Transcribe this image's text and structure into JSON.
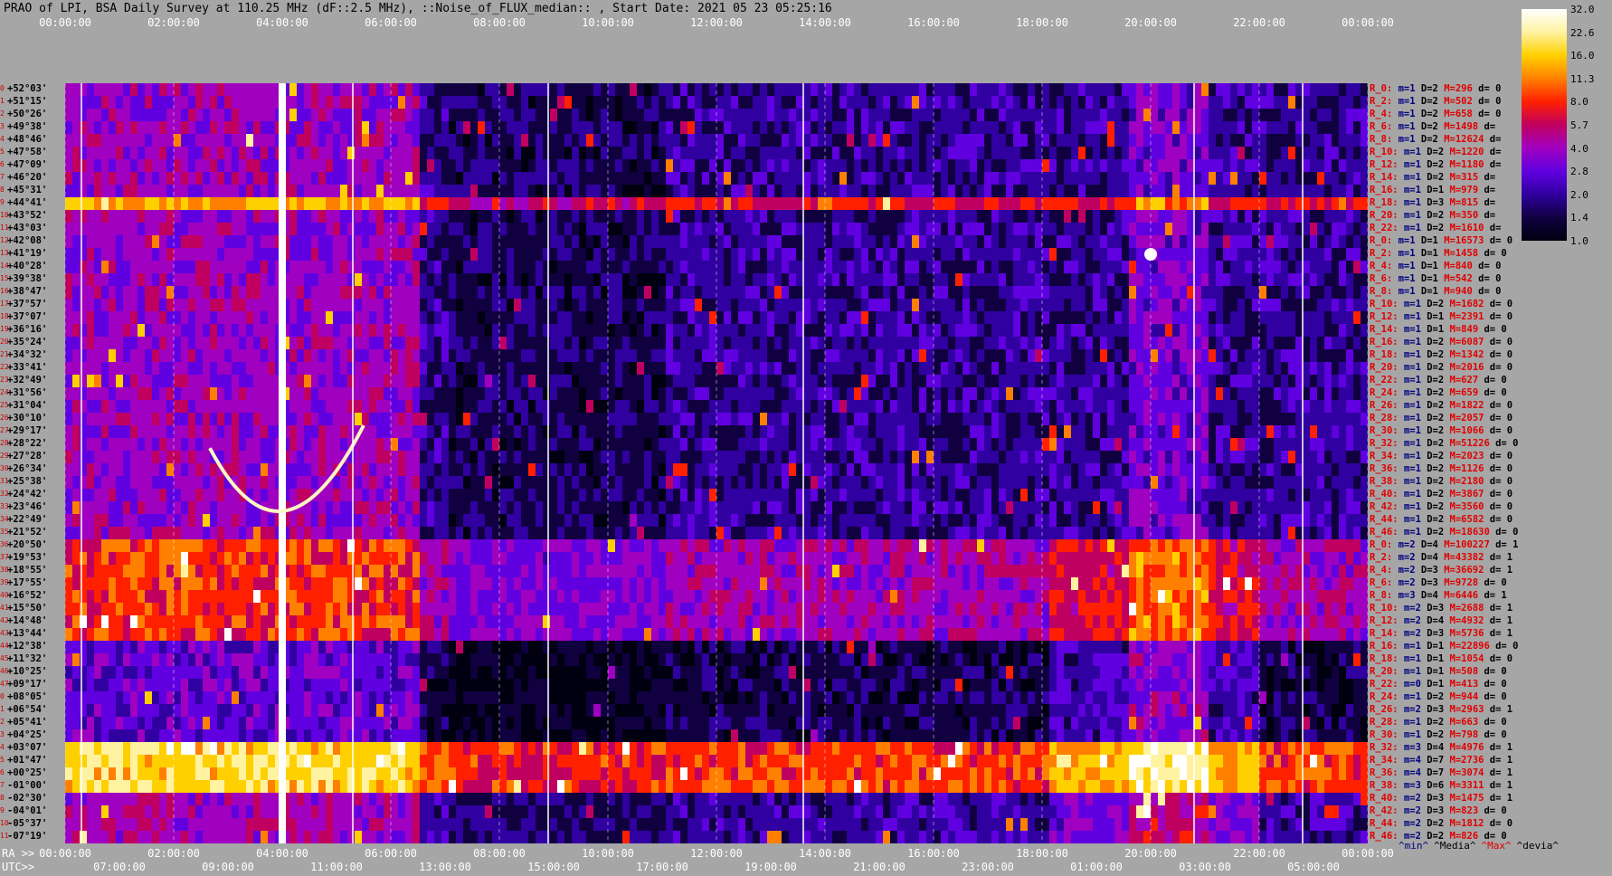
{
  "title": "PRAO of LPI, BSA Daily Survey at 110.25 MHz (dF::2.5 MHz), ::Noise_of_FLUX_median:: , Start Date: 2021 05 23 05:25:16",
  "top_ticks": [
    "00:00:00",
    "02:00:00",
    "04:00:00",
    "06:00:00",
    "08:00:00",
    "10:00:00",
    "12:00:00",
    "14:00:00",
    "16:00:00",
    "18:00:00",
    "20:00:00",
    "22:00:00",
    "00:00:00"
  ],
  "bottom_ra_prefix": "RA >>",
  "bottom_ra_ticks": [
    "00:00:00",
    "02:00:00",
    "04:00:00",
    "06:00:00",
    "08:00:00",
    "10:00:00",
    "12:00:00",
    "14:00:00",
    "16:00:00",
    "18:00:00",
    "20:00:00",
    "22:00:00",
    "00:00:00"
  ],
  "bottom_utc_prefix": "UTC>>",
  "bottom_utc_ticks": [
    "07:00:00",
    "09:00:00",
    "11:00:00",
    "13:00:00",
    "15:00:00",
    "17:00:00",
    "19:00:00",
    "21:00:00",
    "23:00:00",
    "01:00:00",
    "03:00:00",
    "05:00:00"
  ],
  "colorbar": {
    "ticks": [
      "32.0",
      "22.6",
      "16.0",
      "11.3",
      "8.0",
      "5.7",
      "4.0",
      "2.8",
      "2.0",
      "1.4",
      "1.0"
    ],
    "colors": [
      "#ffffff",
      "#fff2a0",
      "#ffd000",
      "#ff8000",
      "#ff2000",
      "#c00060",
      "#a000c0",
      "#6000e0",
      "#3000a0",
      "#100040",
      "#000010"
    ]
  },
  "declinations": [
    "+52°03'",
    "+51°15'",
    "+50°26'",
    "+49°38'",
    "+48°46'",
    "+47°58'",
    "+47°09'",
    "+46°20'",
    "+45°31'",
    "+44°41'",
    "+43°52'",
    "+43°03'",
    "+42°08'",
    "+41°19'",
    "+40°28'",
    "+39°38'",
    "+38°47'",
    "+37°57'",
    "+37°07'",
    "+36°16'",
    "+35°24'",
    "+34°32'",
    "+33°41'",
    "+32°49'",
    "+31°56'",
    "+31°04'",
    "+30°10'",
    "+29°17'",
    "+28°22'",
    "+27°28'",
    "+26°34'",
    "+25°38'",
    "+24°42'",
    "+23°46'",
    "+22°49'",
    "+21°52'",
    "+20°50'",
    "+19°53'",
    "+18°55'",
    "+17°55'",
    "+16°52'",
    "+15°50'",
    "+14°48'",
    "+13°44'",
    "+12°38'",
    "+11°32'",
    "+10°25'",
    "+09°17'",
    "+08°05'",
    "+06°54'",
    "+05°41'",
    "+04°25'",
    "+03°07'",
    "+01°47'",
    "+00°25'",
    "-01°00'",
    "-02°30'",
    "-04°01'",
    "-05°37'",
    "-07°19'"
  ],
  "stats": [
    {
      "r": "R_0:",
      "m": "m=1",
      "D": "D=2",
      "M": "M=296",
      "d": "d= 0"
    },
    {
      "r": "R_2:",
      "m": "m=1",
      "D": "D=2",
      "M": "M=502",
      "d": "d= 0"
    },
    {
      "r": "R_4:",
      "m": "m=1",
      "D": "D=2",
      "M": "M=658",
      "d": "d= 0"
    },
    {
      "r": "R_6:",
      "m": "m=1",
      "D": "D=2",
      "M": "M=1498",
      "d": "d="
    },
    {
      "r": "R_8:",
      "m": "m=1",
      "D": "D=2",
      "M": "M=12624",
      "d": "d="
    },
    {
      "r": "R_10:",
      "m": "m=1",
      "D": "D=2",
      "M": "M=1220",
      "d": "d="
    },
    {
      "r": "R_12:",
      "m": "m=1",
      "D": "D=2",
      "M": "M=1180",
      "d": "d="
    },
    {
      "r": "R_14:",
      "m": "m=1",
      "D": "D=2",
      "M": "M=315",
      "d": "d="
    },
    {
      "r": "R_16:",
      "m": "m=1",
      "D": "D=1",
      "M": "M=979",
      "d": "d="
    },
    {
      "r": "R_18:",
      "m": "m=1",
      "D": "D=3",
      "M": "M=815",
      "d": "d="
    },
    {
      "r": "R_20:",
      "m": "m=1",
      "D": "D=2",
      "M": "M=350",
      "d": "d="
    },
    {
      "r": "R_22:",
      "m": "m=1",
      "D": "D=2",
      "M": "M=1610",
      "d": "d="
    },
    {
      "r": "R_0:",
      "m": "m=1",
      "D": "D=1",
      "M": "M=16573",
      "d": "d= 0"
    },
    {
      "r": "R_2:",
      "m": "m=1",
      "D": "D=1",
      "M": "M=1458",
      "d": "d= 0"
    },
    {
      "r": "R_4:",
      "m": "m=1",
      "D": "D=1",
      "M": "M=840",
      "d": "d= 0"
    },
    {
      "r": "R_6:",
      "m": "m=1",
      "D": "D=1",
      "M": "M=542",
      "d": "d= 0"
    },
    {
      "r": "R_8:",
      "m": "m=1",
      "D": "D=1",
      "M": "M=940",
      "d": "d= 0"
    },
    {
      "r": "R_10:",
      "m": "m=1",
      "D": "D=2",
      "M": "M=1682",
      "d": "d= 0"
    },
    {
      "r": "R_12:",
      "m": "m=1",
      "D": "D=1",
      "M": "M=2391",
      "d": "d= 0"
    },
    {
      "r": "R_14:",
      "m": "m=1",
      "D": "D=1",
      "M": "M=849",
      "d": "d= 0"
    },
    {
      "r": "R_16:",
      "m": "m=1",
      "D": "D=2",
      "M": "M=6087",
      "d": "d= 0"
    },
    {
      "r": "R_18:",
      "m": "m=1",
      "D": "D=2",
      "M": "M=1342",
      "d": "d= 0"
    },
    {
      "r": "R_20:",
      "m": "m=1",
      "D": "D=2",
      "M": "M=2016",
      "d": "d= 0"
    },
    {
      "r": "R_22:",
      "m": "m=1",
      "D": "D=2",
      "M": "M=627",
      "d": "d= 0"
    },
    {
      "r": "R_24:",
      "m": "m=1",
      "D": "D=2",
      "M": "M=659",
      "d": "d= 0"
    },
    {
      "r": "R_26:",
      "m": "m=1",
      "D": "D=2",
      "M": "M=1822",
      "d": "d= 0"
    },
    {
      "r": "R_28:",
      "m": "m=1",
      "D": "D=2",
      "M": "M=2057",
      "d": "d= 0"
    },
    {
      "r": "R_30:",
      "m": "m=1",
      "D": "D=2",
      "M": "M=1066",
      "d": "d= 0"
    },
    {
      "r": "R_32:",
      "m": "m=1",
      "D": "D=2",
      "M": "M=51226",
      "d": "d= 0"
    },
    {
      "r": "R_34:",
      "m": "m=1",
      "D": "D=2",
      "M": "M=2023",
      "d": "d= 0"
    },
    {
      "r": "R_36:",
      "m": "m=1",
      "D": "D=2",
      "M": "M=1126",
      "d": "d= 0"
    },
    {
      "r": "R_38:",
      "m": "m=1",
      "D": "D=2",
      "M": "M=2180",
      "d": "d= 0"
    },
    {
      "r": "R_40:",
      "m": "m=1",
      "D": "D=2",
      "M": "M=3867",
      "d": "d= 0"
    },
    {
      "r": "R_42:",
      "m": "m=1",
      "D": "D=2",
      "M": "M=3560",
      "d": "d= 0"
    },
    {
      "r": "R_44:",
      "m": "m=1",
      "D": "D=2",
      "M": "M=6582",
      "d": "d= 0"
    },
    {
      "r": "R_46:",
      "m": "m=1",
      "D": "D=2",
      "M": "M=18630",
      "d": "d= 0"
    },
    {
      "r": "R_0:",
      "m": "m=2",
      "D": "D=4",
      "M": "M=100227",
      "d": "d= 1"
    },
    {
      "r": "R_2:",
      "m": "m=2",
      "D": "D=4",
      "M": "M=43382",
      "d": "d= 1"
    },
    {
      "r": "R_4:",
      "m": "m=2",
      "D": "D=3",
      "M": "M=36692",
      "d": "d= 1"
    },
    {
      "r": "R_6:",
      "m": "m=2",
      "D": "D=3",
      "M": "M=9728",
      "d": "d= 0"
    },
    {
      "r": "R_8:",
      "m": "m=3",
      "D": "D=4",
      "M": "M=6446",
      "d": "d= 1"
    },
    {
      "r": "R_10:",
      "m": "m=2",
      "D": "D=3",
      "M": "M=2688",
      "d": "d= 1"
    },
    {
      "r": "R_12:",
      "m": "m=2",
      "D": "D=4",
      "M": "M=4932",
      "d": "d= 1"
    },
    {
      "r": "R_14:",
      "m": "m=2",
      "D": "D=3",
      "M": "M=5736",
      "d": "d= 1"
    },
    {
      "r": "R_16:",
      "m": "m=1",
      "D": "D=1",
      "M": "M=22896",
      "d": "d= 0"
    },
    {
      "r": "R_18:",
      "m": "m=1",
      "D": "D=1",
      "M": "M=1054",
      "d": "d= 0"
    },
    {
      "r": "R_20:",
      "m": "m=1",
      "D": "D=1",
      "M": "M=508",
      "d": "d= 0"
    },
    {
      "r": "R_22:",
      "m": "m=0",
      "D": "D=1",
      "M": "M=413",
      "d": "d= 0"
    },
    {
      "r": "R_24:",
      "m": "m=1",
      "D": "D=2",
      "M": "M=944",
      "d": "d= 0"
    },
    {
      "r": "R_26:",
      "m": "m=2",
      "D": "D=3",
      "M": "M=2963",
      "d": "d= 1"
    },
    {
      "r": "R_28:",
      "m": "m=1",
      "D": "D=2",
      "M": "M=663",
      "d": "d= 0"
    },
    {
      "r": "R_30:",
      "m": "m=1",
      "D": "D=2",
      "M": "M=798",
      "d": "d= 0"
    },
    {
      "r": "R_32:",
      "m": "m=3",
      "D": "D=4",
      "M": "M=4976",
      "d": "d= 1"
    },
    {
      "r": "R_34:",
      "m": "m=4",
      "D": "D=7",
      "M": "M=2736",
      "d": "d= 1"
    },
    {
      "r": "R_36:",
      "m": "m=4",
      "D": "D=7",
      "M": "M=3074",
      "d": "d= 1"
    },
    {
      "r": "R_38:",
      "m": "m=3",
      "D": "D=6",
      "M": "M=3311",
      "d": "d= 1"
    },
    {
      "r": "R_40:",
      "m": "m=2",
      "D": "D=3",
      "M": "M=1475",
      "d": "d= 1"
    },
    {
      "r": "R_42:",
      "m": "m=2",
      "D": "D=3",
      "M": "M=823",
      "d": "d= 0"
    },
    {
      "r": "R_44:",
      "m": "m=2",
      "D": "D=2",
      "M": "M=1812",
      "d": "d= 0"
    },
    {
      "r": "R_46:",
      "m": "m=2",
      "D": "D=2",
      "M": "M=826",
      "d": "d= 0"
    }
  ],
  "legend_keys": [
    {
      "label": "^min^",
      "color": "#000080"
    },
    {
      "label": "^Media^",
      "color": "#000000"
    },
    {
      "label": "^Max^",
      "color": "#e00000"
    },
    {
      "label": "^devia^",
      "color": "#000000"
    }
  ],
  "chart_data": {
    "type": "heatmap",
    "title": "PRAO of LPI, BSA Daily Survey at 110.25 MHz (dF::2.5 MHz), ::Noise_of_FLUX_median:: , Start Date: 2021 05 23 05:25:16",
    "x_axis_top": "RA 00:00:00 - 00:00:00",
    "x_axis_bottom_ra": "RA 00:00:00 - 00:00:00",
    "x_axis_bottom_utc": "UTC 07:00:00 - 05:00:00",
    "y_axis": "Declination +52°03' to -07°19'",
    "color_scale": [
      1.0,
      1.4,
      2.0,
      2.8,
      4.0,
      5.7,
      8.0,
      11.3,
      16.0,
      22.6,
      32.0
    ],
    "bright_features": [
      {
        "ra_hours": 4.0,
        "note": "bright vertical source track"
      },
      {
        "ra_hours": 20.0,
        "dec": "+40°28'",
        "note": "bright point source"
      },
      {
        "dec_band": "+03°07' to -01°00'",
        "note": "high flux band"
      }
    ]
  }
}
